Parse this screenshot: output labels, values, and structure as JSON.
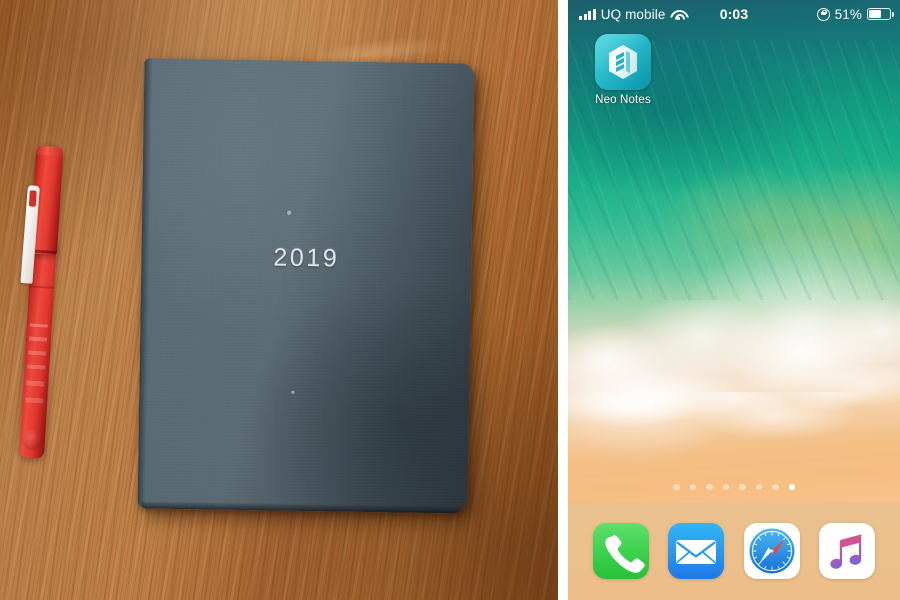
{
  "composite": {
    "layout": "side-by-side",
    "left_caption": "photo-of-notebook-and-pen",
    "right_caption": "iphone-home-screen-screenshot"
  },
  "photo": {
    "notebook": {
      "cover_text": "2019",
      "cover_color": "#4d5d67",
      "description": "dark slate grey hardcover notebook"
    },
    "pen": {
      "color": "#d8352c",
      "clip_color": "#f2f0ec",
      "description": "red capped pen with white clip"
    },
    "surface": {
      "material": "wood table",
      "color": "#b0703a"
    }
  },
  "phone": {
    "status_bar": {
      "signal_bars": 4,
      "carrier": "UQ mobile",
      "wifi": "wifi-icon",
      "time": "0:03",
      "rotation_lock": "rotation-lock-icon",
      "battery_percent": "51%",
      "battery_level": 51
    },
    "home_screen": {
      "wallpaper": "ios-beach-wallpaper",
      "apps": [
        {
          "label": "Neo Notes",
          "icon": "neo-notes-icon",
          "bg_color": "#21b3c4"
        }
      ],
      "page_dots": {
        "count": 8,
        "active_index": 7
      }
    },
    "dock": {
      "background": "#f8c28a",
      "items": [
        {
          "label": "Phone",
          "icon": "phone-icon",
          "color": "#3ed24f"
        },
        {
          "label": "Mail",
          "icon": "mail-icon",
          "color": "#2a9bf0"
        },
        {
          "label": "Safari",
          "icon": "safari-icon",
          "color": "#1f7bdc"
        },
        {
          "label": "Music",
          "icon": "music-icon",
          "color": "#f2466e"
        }
      ]
    }
  }
}
